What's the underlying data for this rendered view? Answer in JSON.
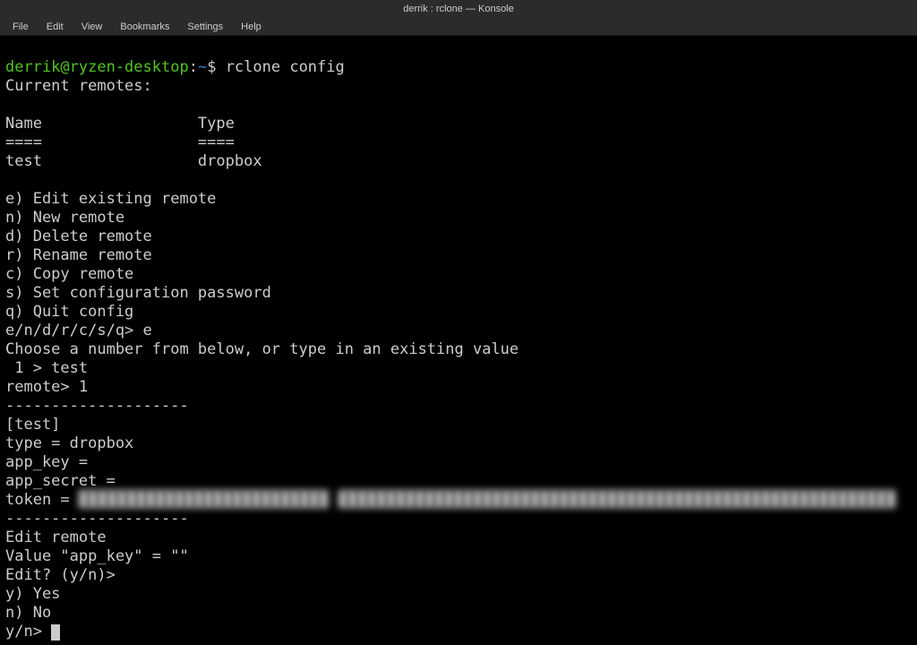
{
  "window": {
    "title": "derrik : rclone — Konsole"
  },
  "menu": {
    "file": "File",
    "edit": "Edit",
    "view": "View",
    "bookmarks": "Bookmarks",
    "settings": "Settings",
    "help": "Help"
  },
  "prompt": {
    "user_host": "derrik@ryzen-desktop",
    "colon": ":",
    "path": "~",
    "dollar": "$ ",
    "command": "rclone config"
  },
  "output": {
    "l1": "Current remotes:",
    "l2": "",
    "l3": "Name                 Type",
    "l4": "====                 ====",
    "l5": "test                 dropbox",
    "l6": "",
    "l7": "e) Edit existing remote",
    "l8": "n) New remote",
    "l9": "d) Delete remote",
    "l10": "r) Rename remote",
    "l11": "c) Copy remote",
    "l12": "s) Set configuration password",
    "l13": "q) Quit config",
    "l14": "e/n/d/r/c/s/q> e",
    "l15": "Choose a number from below, or type in an existing value",
    "l16": " 1 > test",
    "l17": "remote> 1",
    "l18": "--------------------",
    "l19": "[test]",
    "l20": "type = dropbox",
    "l21": "app_key = ",
    "l22": "app_secret = ",
    "l23a": "token = ",
    "l23b": "██████████████████████████ ██████████████████████████████████████████████████████████",
    "l24": "--------------------",
    "l25": "Edit remote",
    "l26": "Value \"app_key\" = \"\"",
    "l27": "Edit? (y/n)>",
    "l28": "y) Yes",
    "l29": "n) No",
    "l30": "y/n> "
  }
}
